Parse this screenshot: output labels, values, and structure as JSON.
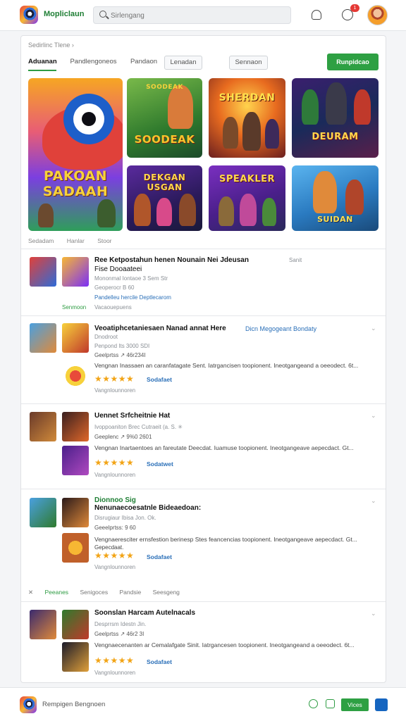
{
  "header": {
    "brand": "Mopliclaun",
    "search_placeholder": "Sirlengang",
    "notification_count": "1"
  },
  "main": {
    "breadcrumb": "Sedirlinc Tlene ›",
    "tabs": [
      "Aduanan",
      "Pandlengoneos",
      "Pandaon",
      "Lenadan",
      "Sennaon"
    ],
    "primary_button": "Runpidcao",
    "art_titles": [
      "PAKOAN SADAAH",
      "SOODEAK",
      "SHERDAN",
      "DEURAM",
      "DEKGAN USGAN",
      "SPEAKLER",
      "SUIDAN"
    ],
    "row_labels": [
      "Sedadam",
      "Hanlar",
      "Stoor"
    ]
  },
  "list": [
    {
      "title": "Ree Ketpostahun henen Nounain Nei Jdeusan",
      "subtitle": "Fise Dooaateei",
      "side": "Sanit",
      "meta1": "Mononmal Iontaoe 3 Sem Str",
      "meta2": "Geoperocr B 60",
      "link": "Pandelleu hercile Deptlecarom",
      "green": "Senmoon",
      "grey": "Vacaouepuens"
    },
    {
      "title": "Veoatiphcetaniesaen Nanad annat Here",
      "title_link": "Dicn Megogeant Bondaty",
      "meta1": "Dnodroot",
      "meta2": "Penpond Its 3000 SDI",
      "meta3": "Geelprtss ↗ 46r234I",
      "desc": "Vengnan Inassaen an caranfatagate Sent. Iatrgancisen toopionent. Ineotgangeand a oeeodect. 6t...",
      "rating": "Sodafaet",
      "footer": "Vangnlounnoren"
    },
    {
      "title": "Uennet Srfcheitnie Hat",
      "meta1": "Ivoppoaniton Brec Cutraeit (a. S. ✳",
      "meta2": "Geeplenc ↗ 9%0 2601",
      "desc": "Vengnan Inartaentoes an fareutate Deecdat. Iuamuse toopionent. Ineotgangeave aepecdact. Gt...",
      "rating": "Sodatwet",
      "footer": "Vangnlounnoren"
    },
    {
      "title_green": "Dionnoo Sig",
      "title": "Nenunaecoesatnle Bideaedoan:",
      "meta1": "Disrugiaur Ibisa Jon. Ok.",
      "meta2": "Geeelprtss: 9 60",
      "desc": "Vengnaeresciter ernsfestion berinesp Stes feancencias toopionent. Ineotgangeave aepecdact. Gt...",
      "desc2": "Gepecdaat.",
      "rating": "Sodafaet",
      "footer": "Vangnlounnoren"
    },
    {
      "title": "Soonslan Harcam Autelnacals",
      "meta1": "Desprrsm Idestn Jin.",
      "meta2": "Geelprtss ↗ 46r2 3I",
      "desc": "Vengnaecenanten ar Cemalafgate Sinit. Iatrgancesen toopionent. Ineotgangeand a oeeodect. 6t...",
      "rating": "Sodafaet",
      "footer": "Vangnlounnoren"
    }
  ],
  "filters": [
    "Peeanes",
    "Senigoces",
    "Pandsie",
    "Seesgeng"
  ],
  "stars": "★★★★★",
  "bottom": {
    "text": "Rempigen Bengnoen",
    "button": "Vices"
  },
  "colors": {
    "accent_green": "#2ea043",
    "link_blue": "#2a6fb8",
    "star_gold": "#f2a416",
    "badge_red": "#e53935"
  }
}
